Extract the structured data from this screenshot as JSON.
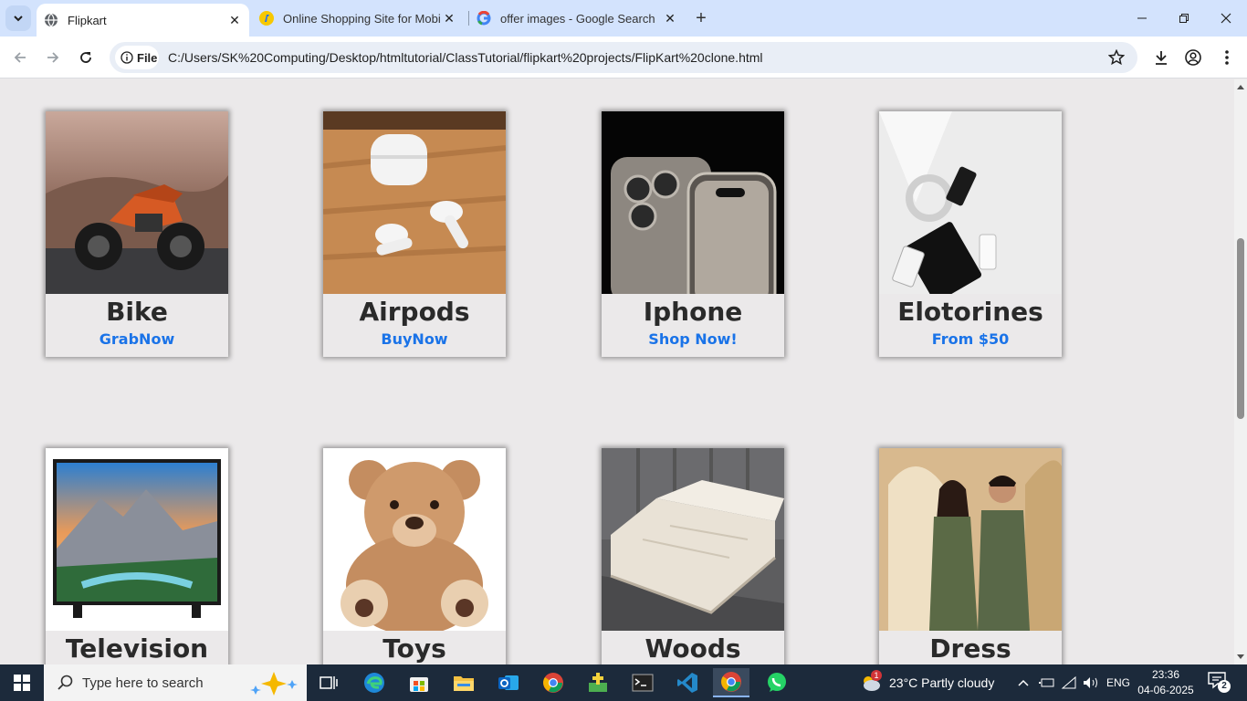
{
  "browser": {
    "tabs": [
      {
        "title": "Flipkart",
        "icon": "globe-icon",
        "active": true
      },
      {
        "title": "Online Shopping Site for Mobile",
        "icon": "flipkart-icon",
        "active": false
      },
      {
        "title": "offer images - Google Search",
        "icon": "google-icon",
        "active": false
      }
    ],
    "chip_label": "File",
    "url": "C:/Users/SK%20Computing/Desktop/htmltutorial/ClassTutorial/flipkart%20projects/FlipKart%20clone.html"
  },
  "products": [
    {
      "name": "Bike",
      "cta": "GrabNow"
    },
    {
      "name": "Airpods",
      "cta": "BuyNow"
    },
    {
      "name": "Iphone",
      "cta": "Shop Now!"
    },
    {
      "name": "Elotorines",
      "cta": "From $50"
    },
    {
      "name": "Television",
      "cta": ""
    },
    {
      "name": "Toys",
      "cta": ""
    },
    {
      "name": "Woods",
      "cta": ""
    },
    {
      "name": "Dress",
      "cta": ""
    }
  ],
  "taskbar": {
    "search_placeholder": "Type here to search",
    "weather": "23°C  Partly cloudy",
    "language": "ENG",
    "time": "23:36",
    "date": "04-06-2025",
    "notifications": "2",
    "weather_badge": "1"
  },
  "colors": {
    "accent": "#1a73e8",
    "tabbar": "#d3e3fd",
    "taskbar": "#1c2a3b"
  }
}
